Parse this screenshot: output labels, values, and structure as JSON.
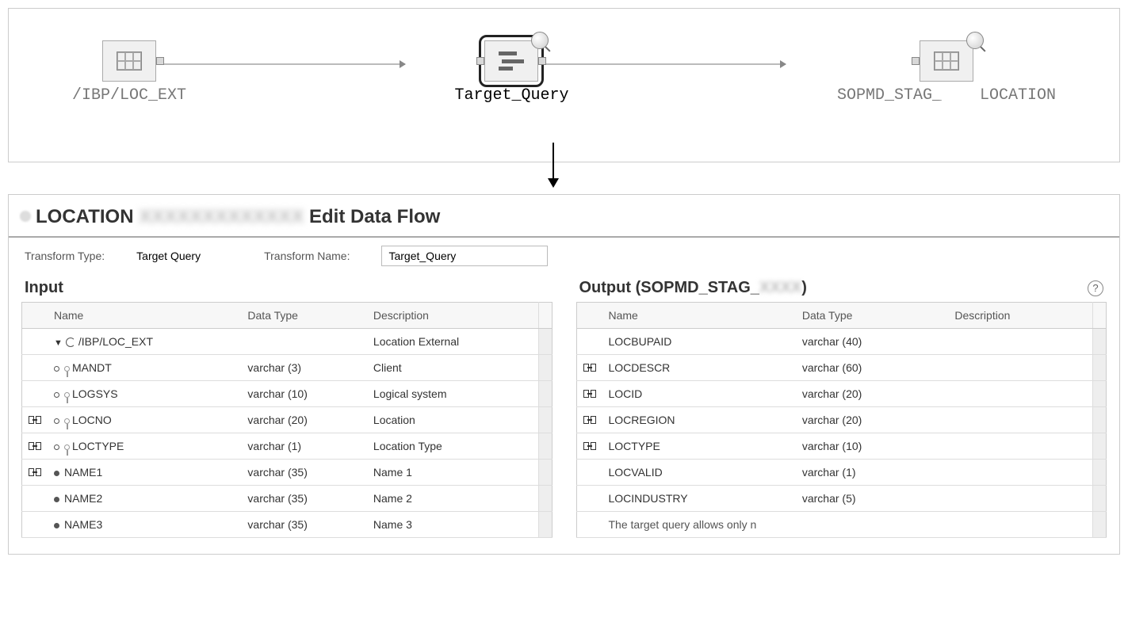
{
  "diagram": {
    "source_label": "/IBP/LOC_EXT",
    "query_label": "Target_Query",
    "target_label_before_redact": "SOPMD_STAG_",
    "target_label_after_redact": "LOCATION"
  },
  "panel": {
    "title_prefix": "LOCATION",
    "title_suffix": "Edit Data Flow",
    "transform_type_label": "Transform Type:",
    "transform_type_value": "Target Query",
    "transform_name_label": "Transform Name:",
    "transform_name_value": "Target_Query"
  },
  "input": {
    "title": "Input",
    "columns": {
      "name": "Name",
      "datatype": "Data Type",
      "description": "Description"
    },
    "root": {
      "name": "/IBP/LOC_EXT",
      "datatype": "",
      "description": "Location External"
    },
    "rows": [
      {
        "mapped": false,
        "key": true,
        "name": "MANDT",
        "datatype": "varchar (3)",
        "description": "Client"
      },
      {
        "mapped": false,
        "key": true,
        "name": "LOGSYS",
        "datatype": "varchar (10)",
        "description": "Logical system"
      },
      {
        "mapped": true,
        "key": true,
        "name": "LOCNO",
        "datatype": "varchar (20)",
        "description": "Location"
      },
      {
        "mapped": true,
        "key": true,
        "name": "LOCTYPE",
        "datatype": "varchar (1)",
        "description": "Location Type"
      },
      {
        "mapped": true,
        "key": false,
        "name": "NAME1",
        "datatype": "varchar (35)",
        "description": "Name 1"
      },
      {
        "mapped": false,
        "key": false,
        "name": "NAME2",
        "datatype": "varchar (35)",
        "description": "Name 2"
      },
      {
        "mapped": false,
        "key": false,
        "name": "NAME3",
        "datatype": "varchar (35)",
        "description": "Name 3"
      }
    ]
  },
  "output": {
    "title_prefix": "Output (SOPMD_STAG_",
    "title_suffix": ")",
    "columns": {
      "name": "Name",
      "datatype": "Data Type",
      "description": "Description"
    },
    "rows": [
      {
        "mapped": false,
        "name": "LOCBUPAID",
        "datatype": "varchar (40)",
        "description": ""
      },
      {
        "mapped": true,
        "name": "LOCDESCR",
        "datatype": "varchar (60)",
        "description": ""
      },
      {
        "mapped": true,
        "name": "LOCID",
        "datatype": "varchar (20)",
        "description": ""
      },
      {
        "mapped": true,
        "name": "LOCREGION",
        "datatype": "varchar (20)",
        "description": ""
      },
      {
        "mapped": true,
        "name": "LOCTYPE",
        "datatype": "varchar (10)",
        "description": ""
      },
      {
        "mapped": false,
        "name": "LOCVALID",
        "datatype": "varchar (1)",
        "description": ""
      },
      {
        "mapped": false,
        "name": "LOCINDUSTRY",
        "datatype": "varchar (5)",
        "description": ""
      }
    ],
    "note": "The target query allows only n"
  }
}
